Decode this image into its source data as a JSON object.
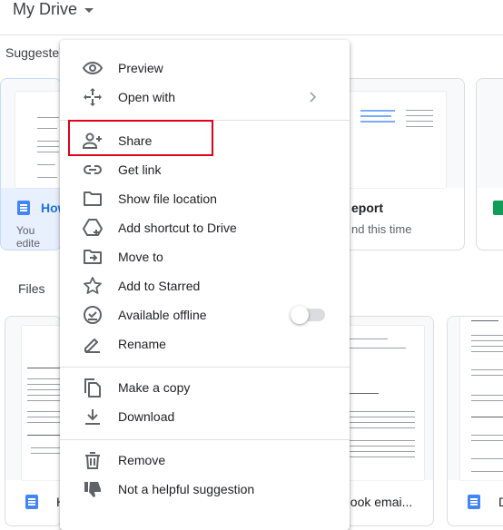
{
  "header": {
    "title": "My Drive"
  },
  "suggested": {
    "label": "Suggeste",
    "cards": [
      {
        "name": "How",
        "sub": "You edite"
      },
      {
        "name": "eport",
        "sub": "nd this time"
      },
      {
        "name": "",
        "sub": ""
      }
    ]
  },
  "files": {
    "label": "Files",
    "cards": [
      {
        "name": "H"
      },
      {
        "name": "utlook emai..."
      },
      {
        "name": "D"
      }
    ]
  },
  "menu": {
    "items": [
      {
        "id": "preview",
        "label": "Preview",
        "icon": "eye-icon"
      },
      {
        "id": "open-with",
        "label": "Open with",
        "icon": "move-arrows-icon"
      },
      {
        "id": "share",
        "label": "Share",
        "icon": "add-person-icon"
      },
      {
        "id": "get-link",
        "label": "Get link",
        "icon": "link-icon"
      },
      {
        "id": "show-location",
        "label": "Show file location",
        "icon": "folder-icon"
      },
      {
        "id": "add-shortcut",
        "label": "Add shortcut to Drive",
        "icon": "drive-shortcut-icon"
      },
      {
        "id": "move-to",
        "label": "Move to",
        "icon": "folder-move-icon"
      },
      {
        "id": "add-starred",
        "label": "Add to Starred",
        "icon": "star-icon"
      },
      {
        "id": "offline",
        "label": "Available offline",
        "icon": "offline-check-icon"
      },
      {
        "id": "rename",
        "label": "Rename",
        "icon": "pencil-icon"
      },
      {
        "id": "copy",
        "label": "Make a copy",
        "icon": "copy-icon"
      },
      {
        "id": "download",
        "label": "Download",
        "icon": "download-icon"
      },
      {
        "id": "remove",
        "label": "Remove",
        "icon": "trash-icon"
      },
      {
        "id": "not-helpful",
        "label": "Not a helpful suggestion",
        "icon": "thumbs-down-icon"
      }
    ]
  }
}
